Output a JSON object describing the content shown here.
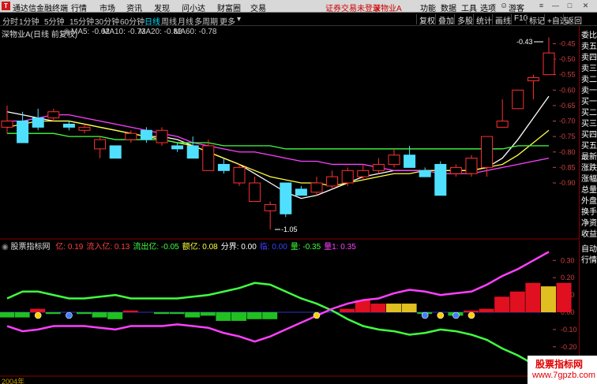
{
  "app": {
    "title": "通达信金融终端",
    "menu": [
      "行情",
      "市场",
      "资讯",
      "发现",
      "问小达",
      "财富圈",
      "交易"
    ],
    "status_left": "证券交易未登录",
    "status_stock": "深物业A",
    "right_menu": [
      "功能",
      "数据",
      "工具",
      "选项"
    ],
    "guest": "游客"
  },
  "toolbar": {
    "periods": [
      "分时",
      "1分钟",
      "5分钟",
      "15分钟",
      "30分钟",
      "60分钟",
      "日线",
      "周线",
      "月线",
      "多周期",
      "更多"
    ],
    "controls": [
      "复权",
      "叠加",
      "多股",
      "统计",
      "画线",
      "F10",
      "标记",
      "+自选",
      "返回"
    ]
  },
  "chart": {
    "title": "深物业A(日线 前复权)",
    "ma": [
      {
        "label": "MA5: -0.62",
        "color": "#ffffff"
      },
      {
        "label": "MA10: -0.73",
        "color": "#ffff40"
      },
      {
        "label": "MA20: -0.82",
        "color": "#ff40ff"
      },
      {
        "label": "MA60: -0.78",
        "color": "#40ff40"
      }
    ],
    "high_label": "-0.43",
    "low_label": "-1.05",
    "price_ticks": [
      "-0.45",
      "-0.50",
      "-0.55",
      "-0.60",
      "-0.65",
      "-0.70",
      "-0.75",
      "-0.80",
      "-0.85",
      "-0.90"
    ]
  },
  "right_panel": [
    "委比",
    "卖五",
    "卖四",
    "卖三",
    "卖二",
    "卖一",
    "买一",
    "买二",
    "买三",
    "买四",
    "买五",
    "最新",
    "涨跌",
    "涨幅",
    "总量",
    "外盘",
    "换手",
    "净资",
    "收益"
  ],
  "right_panel2": [
    "自动",
    "行情"
  ],
  "indicator": {
    "name": "股票指标网",
    "items": [
      {
        "label": "亿: 0.19",
        "color": "#ff4040"
      },
      {
        "label": "流入亿: 0.13",
        "color": "#ff4040"
      },
      {
        "label": "流出亿: -0.05",
        "color": "#40ff40"
      },
      {
        "label": "额亿: 0.08",
        "color": "#ffff40"
      },
      {
        "label": "分界: 0.00",
        "color": "#ffffff"
      },
      {
        "label": "临: 0.00",
        "color": "#4040ff"
      },
      {
        "label": "量: -0.35",
        "color": "#40ff40"
      },
      {
        "label": "量1: 0.35",
        "color": "#ff40ff"
      }
    ],
    "ticks": [
      "0.30",
      "0.20",
      "0.10",
      "0.00",
      "-0.10",
      "-0.20"
    ]
  },
  "date": "2004年",
  "watermark": {
    "line1": "股票指标网",
    "line2": "www.7gpzb.com"
  },
  "chart_data": {
    "type": "candlestick",
    "price_axis": [
      -0.45,
      -0.5,
      -0.55,
      -0.6,
      -0.65,
      -0.7,
      -0.75,
      -0.8,
      -0.85,
      -0.9
    ],
    "candles": [
      {
        "o": -0.72,
        "c": -0.7,
        "h": -0.65,
        "l": -0.74
      },
      {
        "o": -0.7,
        "c": -0.77,
        "h": -0.67,
        "l": -0.77
      },
      {
        "o": -0.69,
        "c": -0.72,
        "h": -0.66,
        "l": -0.73
      },
      {
        "o": -0.69,
        "c": -0.67,
        "h": -0.66,
        "l": -0.7
      },
      {
        "o": -0.71,
        "c": -0.72,
        "h": -0.7,
        "l": -0.73
      },
      {
        "o": -0.73,
        "c": -0.72,
        "h": -0.71,
        "l": -0.74
      },
      {
        "o": -0.79,
        "c": -0.76,
        "h": -0.75,
        "l": -0.82
      },
      {
        "o": -0.78,
        "c": -0.82,
        "h": -0.78,
        "l": -0.82
      },
      {
        "o": -0.76,
        "c": -0.74,
        "h": -0.73,
        "l": -0.77
      },
      {
        "o": -0.73,
        "c": -0.76,
        "h": -0.72,
        "l": -0.77
      },
      {
        "o": -0.77,
        "c": -0.73,
        "h": -0.72,
        "l": -0.78
      },
      {
        "o": -0.78,
        "c": -0.79,
        "h": -0.77,
        "l": -0.8
      },
      {
        "o": -0.78,
        "c": -0.82,
        "h": -0.75,
        "l": -0.82
      },
      {
        "o": -0.86,
        "c": -0.78,
        "h": -0.76,
        "l": -0.86
      },
      {
        "o": -0.84,
        "c": -0.86,
        "h": -0.82,
        "l": -0.87
      },
      {
        "o": -0.9,
        "c": -0.85,
        "h": -0.84,
        "l": -0.91
      },
      {
        "o": -0.96,
        "c": -0.9,
        "h": -0.88,
        "l": -0.96
      },
      {
        "o": -0.99,
        "c": -0.97,
        "h": -0.96,
        "l": -1.05
      },
      {
        "o": -0.9,
        "c": -1.0,
        "h": -0.9,
        "l": -1.01
      },
      {
        "o": -0.92,
        "c": -0.94,
        "h": -0.91,
        "l": -0.94
      },
      {
        "o": -0.93,
        "c": -0.9,
        "h": -0.88,
        "l": -0.94
      },
      {
        "o": -0.91,
        "c": -0.88,
        "h": -0.86,
        "l": -0.92
      },
      {
        "o": -0.9,
        "c": -0.86,
        "h": -0.85,
        "l": -0.91
      },
      {
        "o": -0.88,
        "c": -0.86,
        "h": -0.84,
        "l": -0.89
      },
      {
        "o": -0.86,
        "c": -0.84,
        "h": -0.82,
        "l": -0.87
      },
      {
        "o": -0.84,
        "c": -0.81,
        "h": -0.79,
        "l": -0.85
      },
      {
        "o": -0.81,
        "c": -0.85,
        "h": -0.78,
        "l": -0.85
      },
      {
        "o": -0.86,
        "c": -0.88,
        "h": -0.85,
        "l": -0.88
      },
      {
        "o": -0.84,
        "c": -0.94,
        "h": -0.83,
        "l": -0.94
      },
      {
        "o": -0.87,
        "c": -0.85,
        "h": -0.84,
        "l": -0.88
      },
      {
        "o": -0.87,
        "c": -0.82,
        "h": -0.81,
        "l": -0.88
      },
      {
        "o": -0.85,
        "c": -0.75,
        "h": -0.75,
        "l": -0.88
      },
      {
        "o": -0.72,
        "c": -0.7,
        "h": -0.63,
        "l": -0.72
      },
      {
        "o": -0.66,
        "c": -0.6,
        "h": -0.6,
        "l": -0.66
      },
      {
        "o": -0.57,
        "c": -0.56,
        "h": -0.55,
        "l": -0.63
      },
      {
        "o": -0.55,
        "c": -0.48,
        "h": -0.43,
        "l": -0.55
      }
    ],
    "ma_series": [
      {
        "name": "MA5",
        "color": "#ffffff",
        "values": [
          -0.67,
          -0.68,
          -0.69,
          -0.7,
          -0.7,
          -0.71,
          -0.72,
          -0.73,
          -0.74,
          -0.75,
          -0.75,
          -0.76,
          -0.78,
          -0.8,
          -0.82,
          -0.84,
          -0.87,
          -0.9,
          -0.93,
          -0.95,
          -0.94,
          -0.92,
          -0.9,
          -0.88,
          -0.87,
          -0.86,
          -0.86,
          -0.86,
          -0.86,
          -0.86,
          -0.86,
          -0.85,
          -0.82,
          -0.76,
          -0.69,
          -0.62
        ]
      },
      {
        "name": "MA10",
        "color": "#ffff40",
        "values": [
          -0.72,
          -0.71,
          -0.7,
          -0.7,
          -0.7,
          -0.71,
          -0.72,
          -0.73,
          -0.74,
          -0.75,
          -0.76,
          -0.77,
          -0.78,
          -0.8,
          -0.82,
          -0.84,
          -0.86,
          -0.88,
          -0.89,
          -0.9,
          -0.9,
          -0.91,
          -0.9,
          -0.89,
          -0.88,
          -0.87,
          -0.87,
          -0.86,
          -0.86,
          -0.86,
          -0.86,
          -0.85,
          -0.84,
          -0.81,
          -0.77,
          -0.73
        ]
      },
      {
        "name": "MA20",
        "color": "#ff40ff",
        "values": [
          -0.7,
          -0.7,
          -0.69,
          -0.68,
          -0.68,
          -0.69,
          -0.7,
          -0.71,
          -0.72,
          -0.73,
          -0.74,
          -0.75,
          -0.77,
          -0.78,
          -0.79,
          -0.8,
          -0.8,
          -0.81,
          -0.82,
          -0.83,
          -0.83,
          -0.84,
          -0.84,
          -0.84,
          -0.85,
          -0.86,
          -0.86,
          -0.86,
          -0.87,
          -0.87,
          -0.87,
          -0.86,
          -0.85,
          -0.84,
          -0.83,
          -0.82
        ]
      },
      {
        "name": "MA60",
        "color": "#40ff40",
        "values": [
          -0.74,
          -0.74,
          -0.74,
          -0.74,
          -0.75,
          -0.75,
          -0.75,
          -0.76,
          -0.76,
          -0.76,
          -0.76,
          -0.77,
          -0.77,
          -0.77,
          -0.78,
          -0.78,
          -0.78,
          -0.78,
          -0.79,
          -0.79,
          -0.79,
          -0.79,
          -0.79,
          -0.79,
          -0.79,
          -0.79,
          -0.79,
          -0.79,
          -0.79,
          -0.79,
          -0.79,
          -0.79,
          -0.79,
          -0.78,
          -0.78,
          -0.78
        ]
      }
    ],
    "indicator_axis": [
      0.3,
      0.2,
      0.1,
      0.0,
      -0.1,
      -0.2
    ],
    "indicator_bars": [
      -0.03,
      -0.03,
      0.02,
      -0.01,
      0.0,
      -0.01,
      -0.03,
      -0.04,
      0.01,
      0.0,
      -0.01,
      -0.01,
      -0.03,
      -0.02,
      -0.05,
      -0.05,
      -0.04,
      -0.04,
      0.0,
      0.0,
      0.0,
      0.0,
      0.02,
      0.07,
      0.05,
      0.05,
      0.05,
      -0.01,
      0.0,
      -0.02,
      0.01,
      0.02,
      0.09,
      0.12,
      0.17,
      0.15,
      0.17
    ],
    "indicator_lines": [
      {
        "name": "量",
        "color": "#40ff40",
        "values": [
          0.08,
          0.12,
          0.12,
          0.1,
          0.08,
          0.08,
          0.09,
          0.1,
          0.08,
          0.08,
          0.08,
          0.08,
          0.09,
          0.1,
          0.12,
          0.14,
          0.17,
          0.16,
          0.12,
          0.08,
          0.05,
          0.01,
          -0.04,
          -0.08,
          -0.1,
          -0.11,
          -0.13,
          -0.12,
          -0.1,
          -0.11,
          -0.13,
          -0.16,
          -0.21,
          -0.25,
          -0.3,
          -0.35
        ]
      },
      {
        "name": "量1",
        "color": "#ff40ff",
        "values": [
          -0.08,
          -0.11,
          -0.1,
          -0.08,
          -0.08,
          -0.08,
          -0.09,
          -0.1,
          -0.08,
          -0.08,
          -0.08,
          -0.07,
          -0.08,
          -0.09,
          -0.12,
          -0.14,
          -0.17,
          -0.14,
          -0.1,
          -0.06,
          -0.02,
          0.02,
          0.05,
          0.07,
          0.08,
          0.11,
          0.13,
          0.12,
          0.1,
          0.11,
          0.12,
          0.16,
          0.21,
          0.25,
          0.3,
          0.35
        ]
      }
    ]
  }
}
